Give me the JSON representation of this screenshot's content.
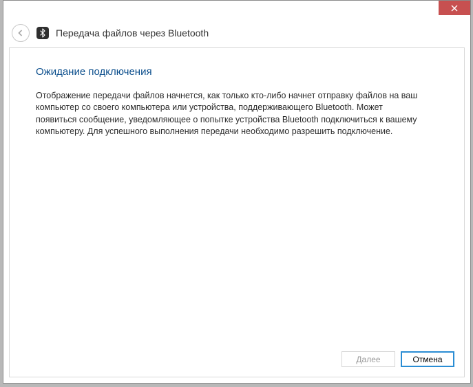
{
  "titlebar": {
    "close_tooltip": "Close"
  },
  "header": {
    "title": "Передача файлов через Bluetooth"
  },
  "content": {
    "heading": "Ожидание подключения",
    "body": "Отображение передачи файлов начнется, как только кто-либо начнет отправку файлов на ваш компьютер со своего компьютера или устройства, поддерживающего Bluetooth. Может появиться сообщение, уведомляющее о попытке устройства Bluetooth подключиться к вашему компьютеру. Для успешного выполнения передачи необходимо разрешить подключение."
  },
  "buttons": {
    "next": "Далее",
    "cancel": "Отмена"
  }
}
